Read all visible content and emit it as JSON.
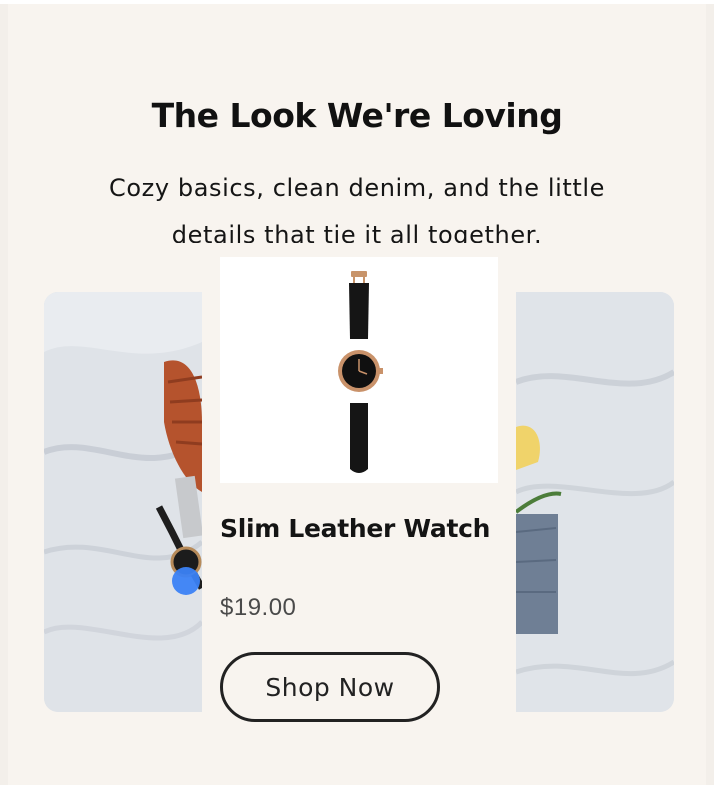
{
  "section": {
    "title": "The Look We're Loving",
    "subtitle": "Cozy basics, clean denim, and the little details that tie it all together."
  },
  "carousel": {
    "active_product": {
      "name": "Slim Leather Watch",
      "price": "$19.00",
      "button_label": "Shop Now",
      "image_icon": "watch-icon"
    }
  },
  "colors": {
    "background": "#f8f4ef",
    "text": "#111111",
    "accent_dot": "#3b82f6"
  }
}
